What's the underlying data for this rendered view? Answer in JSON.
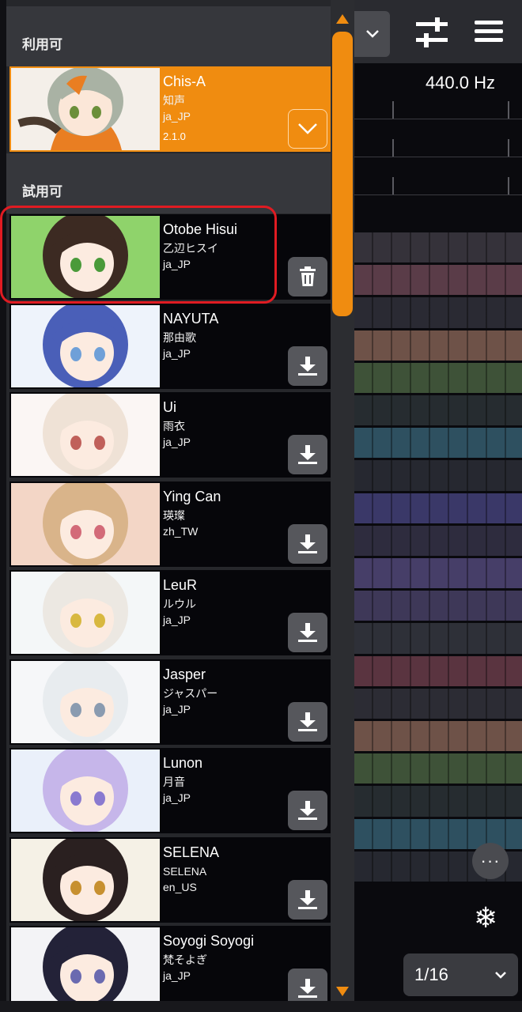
{
  "sections": {
    "available": "利用可",
    "trial": "試用可"
  },
  "selected_voice": {
    "name": "Chis-A",
    "name_local": "知声",
    "lang": "ja_JP",
    "version": "2.1.0",
    "hair": "#a9b2a4",
    "accent": "#e97e22"
  },
  "trial_voices": [
    {
      "name": "Otobe Hisui",
      "name_local": "乙辺ヒスイ",
      "lang": "ja_JP",
      "action": "trash-icon",
      "bg": "#8fd36b",
      "hair": "#3c2a22",
      "eye": "#4a9a3a"
    },
    {
      "name": "NAYUTA",
      "name_local": "那由歌",
      "lang": "ja_JP",
      "action": "download-icon",
      "bg": "#eef3fb",
      "hair": "#4a5fb8",
      "eye": "#6fa0d8"
    },
    {
      "name": "Ui",
      "name_local": "雨衣",
      "lang": "ja_JP",
      "action": "download-icon",
      "bg": "#fbf6f4",
      "hair": "#efe2d6",
      "eye": "#c0605a"
    },
    {
      "name": "Ying Can",
      "name_local": "瑛璨",
      "lang": "zh_TW",
      "action": "download-icon",
      "bg": "#f3d6c6",
      "hair": "#d9b48a",
      "eye": "#d36a78"
    },
    {
      "name": "LeuR",
      "name_local": "ルウル",
      "lang": "ja_JP",
      "action": "download-icon",
      "bg": "#f4f7f8",
      "hair": "#ece8e2",
      "eye": "#d8b840"
    },
    {
      "name": "Jasper",
      "name_local": "ジャスパー",
      "lang": "ja_JP",
      "action": "download-icon",
      "bg": "#f6f7f9",
      "hair": "#e8ecef",
      "eye": "#8a9bb0"
    },
    {
      "name": "Lunon",
      "name_local": "月音",
      "lang": "ja_JP",
      "action": "download-icon",
      "bg": "#eaf0fa",
      "hair": "#c6b6ea",
      "eye": "#8a7ad0"
    },
    {
      "name": "SELENA",
      "name_local": "SELENA",
      "lang": "en_US",
      "action": "download-icon",
      "bg": "#f5f1e6",
      "hair": "#2a2020",
      "eye": "#c79030"
    },
    {
      "name": "Soyogi Soyogi",
      "name_local": "梵そよぎ",
      "lang": "ja_JP",
      "action": "download-icon",
      "bg": "#f3f3f6",
      "hair": "#232238",
      "eye": "#6a6ab0"
    }
  ],
  "editor": {
    "frequency": "440.0 Hz",
    "snap": "1/16",
    "more": "···",
    "freeze": "❄"
  },
  "colors": {
    "accent": "#f08c10",
    "highlight": "#e01b22"
  },
  "grid_rows": [
    "#35323a",
    "#5a3c48",
    "#2a2a33",
    "#6e5248",
    "#3e5238",
    "#262c30",
    "#2e5060",
    "#262830",
    "#3a3868",
    "#2e2c3e",
    "#463e68",
    "#3e3858",
    "#2e3038",
    "#5a3440",
    "#2c2c34",
    "#6e5248",
    "#3e5238",
    "#262c30",
    "#2e5060",
    "#262830"
  ],
  "grid_tints": {
    "grid-row-r": "#643a3a",
    "grid-row-o": "#6e5040",
    "grid-row-g": "#3a5232",
    "grid-row-b": "#2c4c5c",
    "grid-row-p": "#3e3866",
    "grid-row-v": "#463c66"
  }
}
